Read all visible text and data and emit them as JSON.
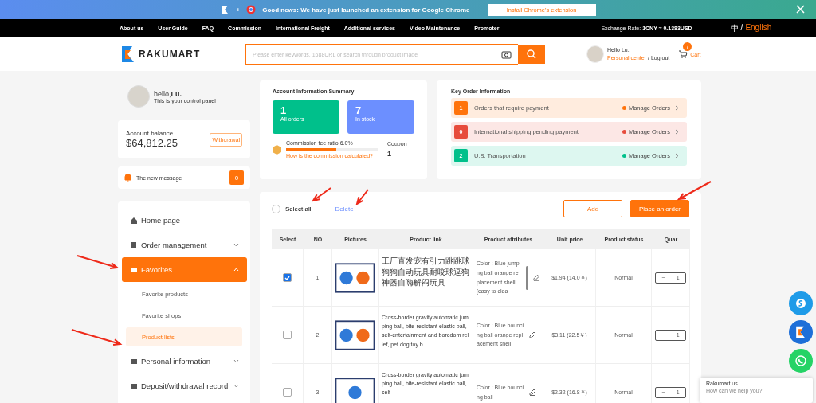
{
  "banner": {
    "plus": "+",
    "text": "Good news: We have just launched an extension for Google Chrome",
    "button": "Install Chrome's extension"
  },
  "nav": {
    "items": [
      "About us",
      "User Guide",
      "FAQ",
      "Commission",
      "International Freight",
      "Additional services",
      "Video Maintenance",
      "Promoter"
    ],
    "exchange_rate": "Exchange Rate: **1CNY ≈ 0.1383USD**",
    "languages": [
      {
        "label": "中",
        "selected": false
      },
      {
        "label": "English",
        "selected": true
      }
    ],
    "language_separator": "/"
  },
  "header": {
    "logo": "RAKUMART",
    "search": {
      "placeholder": "Please enter keywords, 1688URL or search through product image"
    },
    "user": {
      "greeting": "Hello Lu.",
      "personal_center": "Personal center",
      "logout": "/ Log out"
    },
    "cart": {
      "count": "7",
      "label": "Cart"
    }
  },
  "profile": {
    "greeting": "hello,**Lu.**",
    "subtitle": "This is your control panel"
  },
  "balance": {
    "label": "Account balance",
    "amount": "$64,812.25",
    "button": "Withdrawal"
  },
  "message": {
    "label": "The new message",
    "count": "0"
  },
  "sidebar": {
    "items": [
      {
        "label": "Home page",
        "kind": "home",
        "selected": false
      },
      {
        "label": "Order management",
        "kind": "order",
        "expanded": false,
        "selected": false
      },
      {
        "label": "Favorites",
        "kind": "folder",
        "expanded": true,
        "selected": true,
        "children": [
          {
            "label": "Favorite products",
            "selected": false
          },
          {
            "label": "Favorite shops",
            "selected": false
          },
          {
            "label": "Product lists",
            "selected": true
          }
        ]
      },
      {
        "label": "Personal information",
        "kind": "person",
        "expanded": false,
        "selected": false
      },
      {
        "label": "Deposit/withdrawal record",
        "kind": "wallet",
        "expanded": false,
        "selected": false
      }
    ]
  },
  "summary": {
    "title": "Account Information Summary",
    "tiles": [
      {
        "value": "1",
        "label": "All orders",
        "color": "#00c08b"
      },
      {
        "value": "7",
        "label": "In stock",
        "color": "#6c8fff"
      }
    ],
    "commission": {
      "label": "Commission fee ratio 6.0%",
      "level": 0.55,
      "link": "How is the commission calculated?"
    },
    "coupon": {
      "label": "Coupon",
      "value": "1"
    }
  },
  "key_orders": {
    "title": "Key Order Information",
    "rows": [
      {
        "count": "1",
        "label": "Orders that require payment",
        "action": "Manage Orders",
        "color": "#ff730b"
      },
      {
        "count": "0",
        "label": "International shipping pending payment",
        "action": "Manage Orders",
        "color": "#e74c3c"
      },
      {
        "count": "2",
        "label": "U.S. Transportation",
        "action": "Manage Orders",
        "color": "#00c08b"
      }
    ]
  },
  "list": {
    "select_all": {
      "label": "Select all",
      "checked": false
    },
    "delete": "Delete",
    "add": "Add",
    "place_order": "Place an order",
    "columns": [
      "Select",
      "NO",
      "Pictures",
      "Product link",
      "Product attributes",
      "Unit price",
      "Product status",
      "Quar"
    ],
    "rows": [
      {
        "checked": true,
        "no": "1",
        "link": "工厂直发宠有引力跳跳球狗狗自动玩具耐咬球逗狗神器自嗨解闷玩具",
        "attributes": "Color : Blue jumping ball orange replacement shell [easy to clea",
        "scroll": true,
        "price": "$1.94 (14.0￥)",
        "status": "Normal",
        "decrement": "−",
        "quantity": "1"
      },
      {
        "checked": false,
        "no": "2",
        "link": "Cross-border gravity automatic jumping ball, bite-resistant elastic ball, self-entertainment and boredom relief, pet dog toy b…",
        "attributes": "Color : Blue bouncing ball orange replacement shell",
        "scroll": false,
        "price": "$3.11 (22.5￥)",
        "status": "Normal",
        "decrement": "−",
        "quantity": "1"
      },
      {
        "checked": false,
        "no": "3",
        "link": "Cross-border gravity automatic jumping ball, bite-resistant elastic ball, self-",
        "attributes": "Color : Blue bouncing ball",
        "scroll": false,
        "price": "$2.32 (16.8￥)",
        "status": "Normal",
        "decrement": "−",
        "quantity": "1"
      }
    ]
  },
  "chat": {
    "title": "Rakumart us",
    "subtitle": "How can we help you?"
  }
}
